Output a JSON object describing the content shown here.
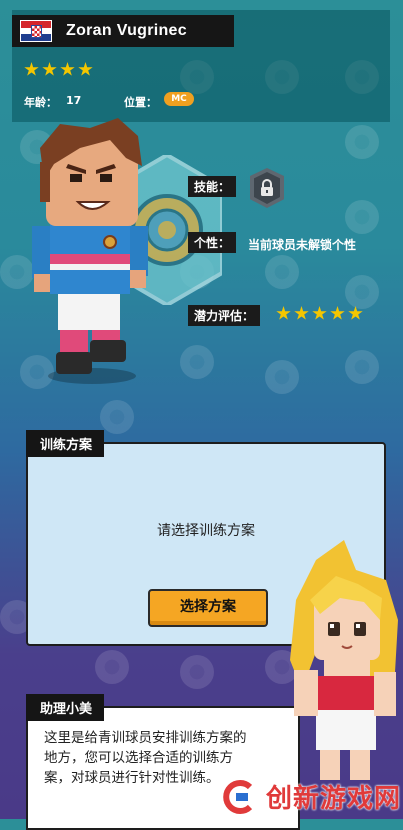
{
  "player": {
    "name": "Zoran Vugrinec",
    "flag": "croatia-flag",
    "star_rating": 4,
    "age_label": "年龄：",
    "age_value": "17",
    "position_label": "位置：",
    "position_value": "MC"
  },
  "attributes": {
    "skill_label": "技能：",
    "skill_icon": "lock-icon",
    "personality_label": "个性：",
    "personality_value": "当前球员未解锁个性",
    "potential_label": "潜力评估：",
    "potential_stars": 5
  },
  "training": {
    "section_title": "训练方案",
    "prompt": "请选择训练方案",
    "button_label": "选择方案"
  },
  "assistant": {
    "section_title": "助理小美",
    "message": "这里是给青训球员安排训练方案的地方，您可以选择合适的训练方案，对球员进行针对性训练。"
  },
  "watermark": {
    "text": "创新游戏网"
  },
  "colors": {
    "accent": "#f5a623",
    "star": "#f4c600",
    "panel_dark": "#161616",
    "watermark": "#e03a3a"
  }
}
